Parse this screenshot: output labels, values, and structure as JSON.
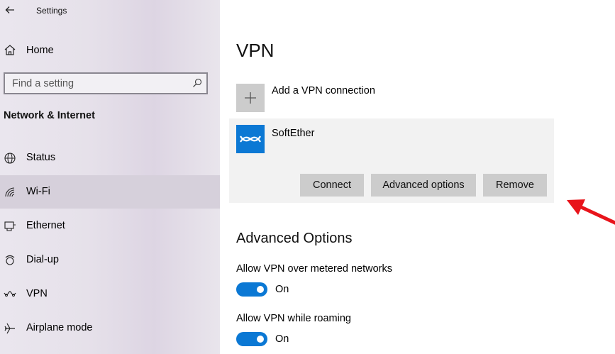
{
  "app": {
    "title": "Settings"
  },
  "sidebar": {
    "home_label": "Home",
    "search_placeholder": "Find a setting",
    "section_title": "Network & Internet",
    "items": [
      {
        "label": "Status",
        "icon": "globe-icon",
        "active": false
      },
      {
        "label": "Wi-Fi",
        "icon": "wifi-icon",
        "active": true
      },
      {
        "label": "Ethernet",
        "icon": "ethernet-icon",
        "active": false
      },
      {
        "label": "Dial-up",
        "icon": "dialup-icon",
        "active": false
      },
      {
        "label": "VPN",
        "icon": "vpn-icon",
        "active": false
      },
      {
        "label": "Airplane mode",
        "icon": "airplane-icon",
        "active": false
      }
    ]
  },
  "main": {
    "title": "VPN",
    "add_connection_label": "Add a VPN connection",
    "connection": {
      "name": "SoftEther",
      "buttons": {
        "connect": "Connect",
        "advanced": "Advanced options",
        "remove": "Remove"
      }
    },
    "advanced": {
      "title": "Advanced Options",
      "toggles": [
        {
          "label": "Allow VPN over metered networks",
          "state": "On"
        },
        {
          "label": "Allow VPN while roaming",
          "state": "On"
        }
      ]
    }
  },
  "colors": {
    "accent": "#0b78d4",
    "arrow": "#e8141b",
    "button": "#cccccc"
  }
}
